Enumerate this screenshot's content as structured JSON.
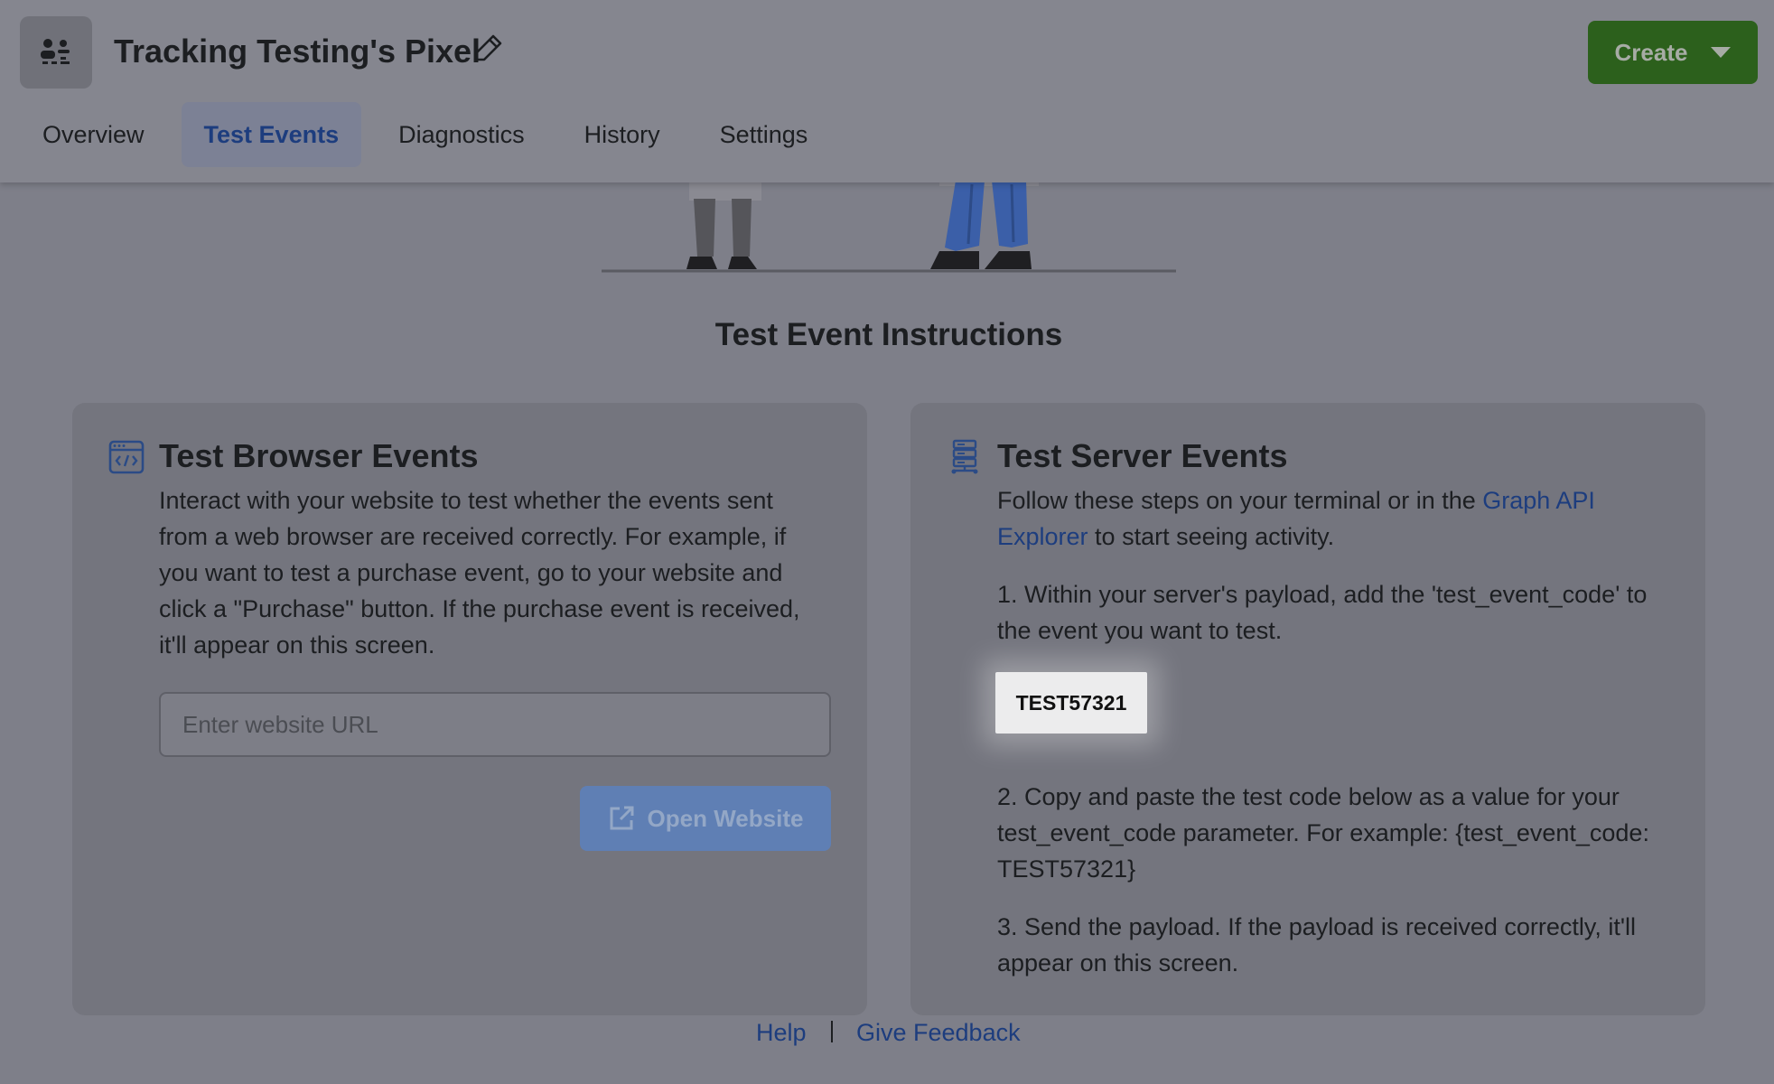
{
  "header": {
    "title": "Tracking Testing's Pixel",
    "create_label": "Create",
    "tabs": [
      {
        "label": "Overview"
      },
      {
        "label": "Test Events"
      },
      {
        "label": "Diagnostics"
      },
      {
        "label": "History"
      },
      {
        "label": "Settings"
      }
    ]
  },
  "main": {
    "instructions_title": "Test Event Instructions",
    "browser": {
      "title": "Test Browser Events",
      "body": "Interact with your website to test whether the events sent from a web browser are received correctly. For example, if you want to test a purchase event, go to your website and click a \"Purchase\" button. If the purchase event is received, it'll appear on this screen.",
      "url_placeholder": "Enter website URL",
      "open_label": "Open Website"
    },
    "server": {
      "title": "Test Server Events",
      "intro_prefix": "Follow these steps on your terminal or in the ",
      "intro_link": "Graph API Explorer",
      "intro_suffix": " to start seeing activity.",
      "step1": "1. Within your server's payload, add the 'test_event_code' to the event you want to test.",
      "test_code": "TEST57321",
      "step2": "2. Copy and paste the test code below as a value for your test_event_code parameter. For example: {test_event_code: TEST57321}",
      "step3": "3. Send the payload. If the payload is received correctly, it'll appear on this screen."
    }
  },
  "footer": {
    "help": "Help",
    "feedback": "Give Feedback"
  }
}
